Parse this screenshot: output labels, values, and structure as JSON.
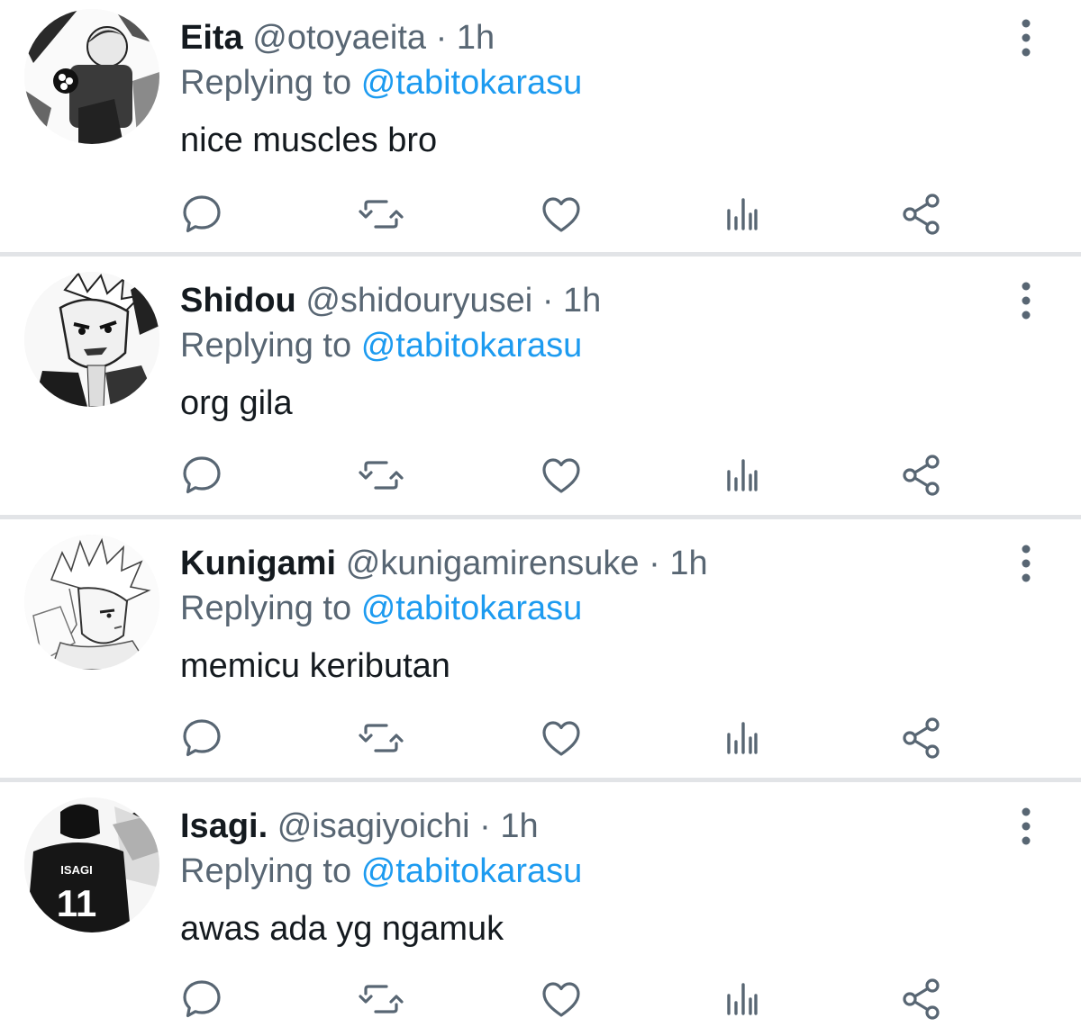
{
  "theme": {
    "name_color": "#141a1f",
    "meta_color": "#586673",
    "mention_color": "#1d9bf0",
    "icon_color": "#586673",
    "divider_color": "#e2e4e7"
  },
  "icons": {
    "reply": "speech-bubble",
    "retweet": "retweet-arrows",
    "like": "heart-outline",
    "views": "bar-chart",
    "share": "share-nodes",
    "more": "vertical-ellipsis"
  },
  "replies": [
    {
      "name": "Eita",
      "handle": "@otoyaeita",
      "separator": "·",
      "time": "1h",
      "replying_prefix": "Replying to",
      "replying_to": "@tabitokarasu",
      "text": "nice muscles bro"
    },
    {
      "name": "Shidou",
      "handle": "@shidouryusei",
      "separator": "·",
      "time": "1h",
      "replying_prefix": "Replying to",
      "replying_to": "@tabitokarasu",
      "text": "org gila"
    },
    {
      "name": "Kunigami",
      "handle": "@kunigamirensuke",
      "separator": "·",
      "time": "1h",
      "replying_prefix": "Replying to",
      "replying_to": "@tabitokarasu",
      "text": "memicu keributan"
    },
    {
      "name": "Isagi.",
      "handle": "@isagiyoichi",
      "separator": "·",
      "time": "1h",
      "replying_prefix": "Replying to",
      "replying_to": "@tabitokarasu",
      "text": "awas ada yg ngamuk",
      "avatar_jersey_name": "ISAGI",
      "avatar_jersey_number": "11"
    }
  ]
}
